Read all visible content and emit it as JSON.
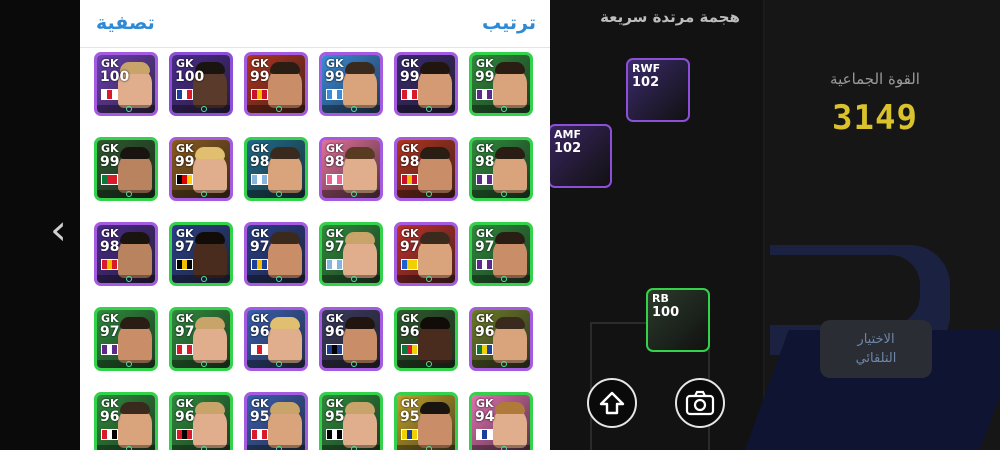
{
  "header": {
    "sort_label": "ترتيب",
    "filter_label": "تصفية"
  },
  "squad": {
    "formation": "هجمة مرتدة سريعة",
    "power_label": "القوة الجماعية",
    "power_value": "3149",
    "auto_select": [
      "الاختيار",
      "التلقائي"
    ]
  },
  "pitch_cards": [
    {
      "pos": "RWF",
      "rating": "102",
      "border": "#8b4fd8",
      "bg": "#3b2a6b"
    },
    {
      "pos": "AMF",
      "rating": "102",
      "border": "#8b4fd8",
      "bg": "#3a2560"
    },
    {
      "pos": "RB",
      "rating": "100",
      "border": "#34d14a",
      "bg": "#2b3b2b"
    }
  ],
  "players": [
    {
      "pos": "GK",
      "rating": "100",
      "border": "#a45be0",
      "bg": "#6a3fb0",
      "flag": [
        "#ffffff",
        "#d91a2a",
        "#ffffff"
      ],
      "skin": "#e0ae8c",
      "hair": "#c9a46a"
    },
    {
      "pos": "GK",
      "rating": "100",
      "border": "#8b4fd8",
      "bg": "#4a2b8c",
      "flag": [
        "#1c3f9a",
        "#ffffff",
        "#d91a2a"
      ],
      "skin": "#5a3a2a",
      "hair": "#1a1410"
    },
    {
      "pos": "GK",
      "rating": "99",
      "border": "#a45be0",
      "bg": "#b0341f",
      "flag": [
        "#c8102e",
        "#f1bf00",
        "#c8102e"
      ],
      "skin": "#c98d68",
      "hair": "#2a1d14"
    },
    {
      "pos": "GK",
      "rating": "99",
      "border": "#a45be0",
      "bg": "#3b8bd8",
      "flag": [
        "#3b8bd8",
        "#ffffff",
        "#3b8bd8"
      ],
      "skin": "#d9a37c",
      "hair": "#3a2a1d"
    },
    {
      "pos": "GK",
      "rating": "99",
      "border": "#a45be0",
      "bg": "#3a2a70",
      "flag": [
        "#d91a2a",
        "#ffffff",
        "#d91a2a"
      ],
      "skin": "#d39a74",
      "hair": "#20160f"
    },
    {
      "pos": "GK",
      "rating": "99",
      "border": "#34d14a",
      "bg": "#2e8b3c",
      "flag": [
        "#5b2a8a",
        "#ffffff",
        "#5b2a8a"
      ],
      "skin": "#d9a37c",
      "hair": "#2a1d14"
    },
    {
      "pos": "GK",
      "rating": "99",
      "border": "#34d14a",
      "bg": "#2c5a2e",
      "flag": [
        "#0a7a3a",
        "#d91a2a",
        "#d91a2a"
      ],
      "skin": "#b98360",
      "hair": "#1a1410"
    },
    {
      "pos": "GK",
      "rating": "99",
      "border": "#a45be0",
      "bg": "#8a5a1e",
      "flag": [
        "#000000",
        "#dd0000",
        "#ffce00"
      ],
      "skin": "#e0ae8c",
      "hair": "#e0c070"
    },
    {
      "pos": "GK",
      "rating": "98",
      "border": "#34d14a",
      "bg": "#1f6b8a",
      "flag": [
        "#87b5e0",
        "#ffffff",
        "#87b5e0"
      ],
      "skin": "#d9a37c",
      "hair": "#3a2a1d"
    },
    {
      "pos": "GK",
      "rating": "98",
      "border": "#a45be0",
      "bg": "#e0709a",
      "flag": [
        "#f06292",
        "#ffffff",
        "#f06292"
      ],
      "skin": "#e0ae8c",
      "hair": "#5a3a20"
    },
    {
      "pos": "GK",
      "rating": "98",
      "border": "#a45be0",
      "bg": "#b0341f",
      "flag": [
        "#c8102e",
        "#f1bf00",
        "#c8102e"
      ],
      "skin": "#c98d68",
      "hair": "#2a1d14"
    },
    {
      "pos": "GK",
      "rating": "98",
      "border": "#34d14a",
      "bg": "#2e8b3c",
      "flag": [
        "#5b2a8a",
        "#ffffff",
        "#5b2a8a"
      ],
      "skin": "#d9a37c",
      "hair": "#2a1d14"
    },
    {
      "pos": "GK",
      "rating": "98",
      "border": "#a45be0",
      "bg": "#4a2b8c",
      "flag": [
        "#d91a2a",
        "#f1bf00",
        "#d91a2a"
      ],
      "skin": "#b98360",
      "hair": "#1a1410"
    },
    {
      "pos": "GK",
      "rating": "97",
      "border": "#34d14a",
      "bg": "#2a3f8a",
      "flag": [
        "#000000",
        "#f1bf00",
        "#000000"
      ],
      "skin": "#4a2c1e",
      "hair": "#120c08"
    },
    {
      "pos": "GK",
      "rating": "97",
      "border": "#a45be0",
      "bg": "#2a3f8a",
      "flag": [
        "#1c3f9a",
        "#f1bf00",
        "#1c3f9a"
      ],
      "skin": "#c98d68",
      "hair": "#3a2a1d"
    },
    {
      "pos": "GK",
      "rating": "97",
      "border": "#34d14a",
      "bg": "#2e8b3c",
      "flag": [
        "#87b5e0",
        "#ffffff",
        "#87b5e0"
      ],
      "skin": "#e0ae8c",
      "hair": "#c9a46a"
    },
    {
      "pos": "GK",
      "rating": "97",
      "border": "#a45be0",
      "bg": "#c0302a",
      "flag": [
        "#1c5fd0",
        "#f1d000",
        "#f1d000"
      ],
      "skin": "#d9a37c",
      "hair": "#3a2a1d"
    },
    {
      "pos": "GK",
      "rating": "97",
      "border": "#34d14a",
      "bg": "#2e8b3c",
      "flag": [
        "#5b2a8a",
        "#ffffff",
        "#5b2a8a"
      ],
      "skin": "#c98d68",
      "hair": "#2a1d14"
    },
    {
      "pos": "GK",
      "rating": "97",
      "border": "#34d14a",
      "bg": "#2e8b3c",
      "flag": [
        "#5b2a8a",
        "#ffffff",
        "#5b2a8a"
      ],
      "skin": "#c98d68",
      "hair": "#2a1d14"
    },
    {
      "pos": "GK",
      "rating": "97",
      "border": "#34d14a",
      "bg": "#2e8b3c",
      "flag": [
        "#d91a2a",
        "#ffffff",
        "#d91a2a"
      ],
      "skin": "#e0ae8c",
      "hair": "#c9a46a"
    },
    {
      "pos": "GK",
      "rating": "96",
      "border": "#a45be0",
      "bg": "#3a5fb0",
      "flag": [
        "#ffffff",
        "#d91a2a",
        "#ffffff"
      ],
      "skin": "#e0ae8c",
      "hair": "#e0c070"
    },
    {
      "pos": "GK",
      "rating": "96",
      "border": "#a45be0",
      "bg": "#3a3a60",
      "flag": [
        "#1c3f9a",
        "#000000",
        "#1c3f9a"
      ],
      "skin": "#c98d68",
      "hair": "#20160f"
    },
    {
      "pos": "GK",
      "rating": "96",
      "border": "#34d14a",
      "bg": "#2e5a2e",
      "flag": [
        "#0a7a3a",
        "#d91a2a",
        "#f1d000"
      ],
      "skin": "#4a2c1e",
      "hair": "#120c08"
    },
    {
      "pos": "GK",
      "rating": "96",
      "border": "#a45be0",
      "bg": "#6b7a2a",
      "flag": [
        "#0a7a3a",
        "#f1d000",
        "#1c3f9a"
      ],
      "skin": "#d9a37c",
      "hair": "#3a2a1d"
    },
    {
      "pos": "GK",
      "rating": "96",
      "border": "#34d14a",
      "bg": "#2e8b3c",
      "flag": [
        "#d91a2a",
        "#ffffff",
        "#000000"
      ],
      "skin": "#d9a37c",
      "hair": "#3a2a1d"
    },
    {
      "pos": "GK",
      "rating": "96",
      "border": "#34d14a",
      "bg": "#2e8b3c",
      "flag": [
        "#d91a2a",
        "#000000",
        "#d91a2a"
      ],
      "skin": "#e0ae8c",
      "hair": "#c9a46a"
    },
    {
      "pos": "GK",
      "rating": "95",
      "border": "#a45be0",
      "bg": "#3a5fb0",
      "flag": [
        "#d91a2a",
        "#ffffff",
        "#d91a2a"
      ],
      "skin": "#d9a37c",
      "hair": "#c9a46a"
    },
    {
      "pos": "GK",
      "rating": "95",
      "border": "#34d14a",
      "bg": "#2e8b3c",
      "flag": [
        "#000000",
        "#ffffff",
        "#000000"
      ],
      "skin": "#e0ae8c",
      "hair": "#c9a46a"
    },
    {
      "pos": "GK",
      "rating": "95",
      "border": "#34d14a",
      "bg": "#c0a02a",
      "flag": [
        "#f1d000",
        "#1c3f9a",
        "#f1d000"
      ],
      "skin": "#c98d68",
      "hair": "#1a1410"
    },
    {
      "pos": "GK",
      "rating": "94",
      "border": "#34d14a",
      "bg": "#e070b0",
      "flag": [
        "#ffffff",
        "#1c3f9a",
        "#ffffff"
      ],
      "skin": "#e0ae8c",
      "hair": "#b07a3a"
    }
  ]
}
